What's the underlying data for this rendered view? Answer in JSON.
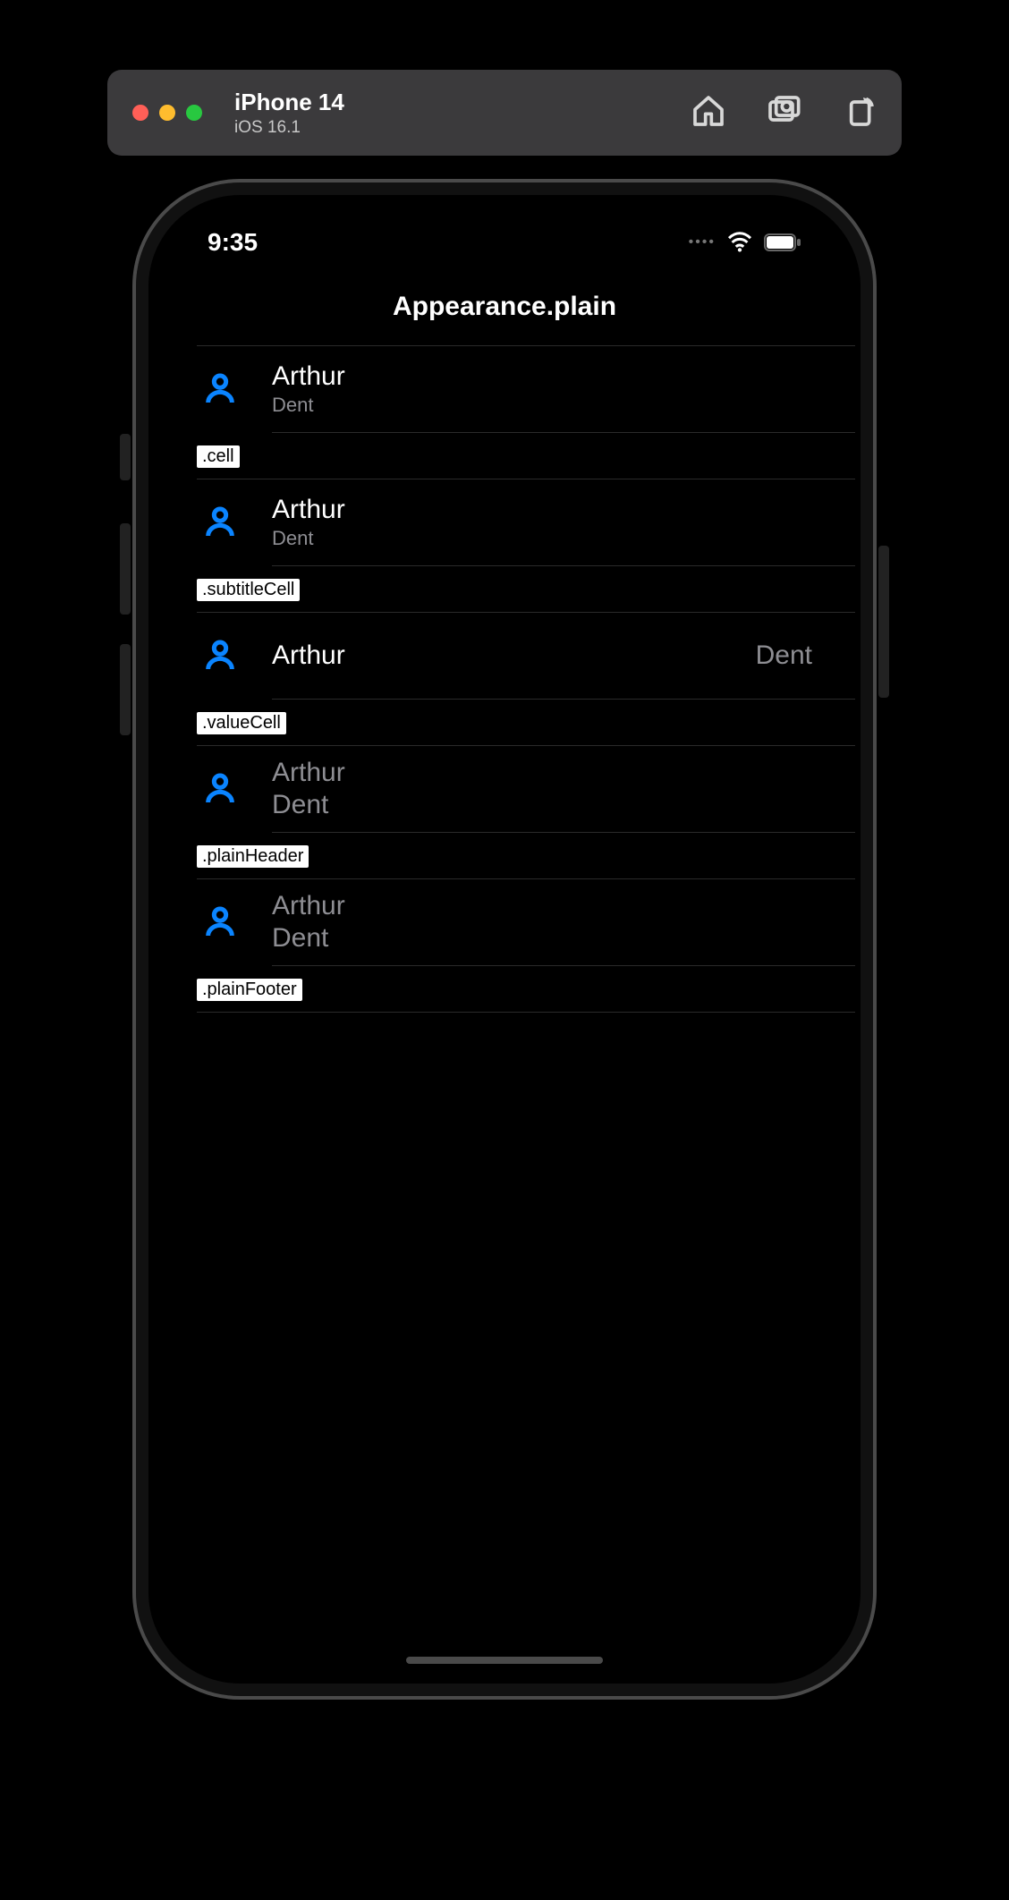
{
  "simulator": {
    "device": "iPhone 14",
    "os": "iOS 16.1"
  },
  "statusBar": {
    "time": "9:35"
  },
  "nav": {
    "title": "Appearance.plain"
  },
  "sections": [
    {
      "headerTag": null,
      "style": "subtitle",
      "title": "Arthur",
      "subtitle": "Dent",
      "footerTag": ".cell"
    },
    {
      "headerTag": null,
      "style": "subtitle",
      "title": "Arthur",
      "subtitle": "Dent",
      "footerTag": ".subtitleCell"
    },
    {
      "headerTag": null,
      "style": "value",
      "title": "Arthur",
      "value": "Dent",
      "footerTag": ".valueCell"
    },
    {
      "headerTag": null,
      "style": "plainHeaderLike",
      "title": "Arthur",
      "body": "Dent",
      "footerTag": ".plainHeader"
    },
    {
      "headerTag": null,
      "style": "plainHeaderLike",
      "title": "Arthur",
      "body": "Dent",
      "footerTag": ".plainFooter"
    }
  ]
}
